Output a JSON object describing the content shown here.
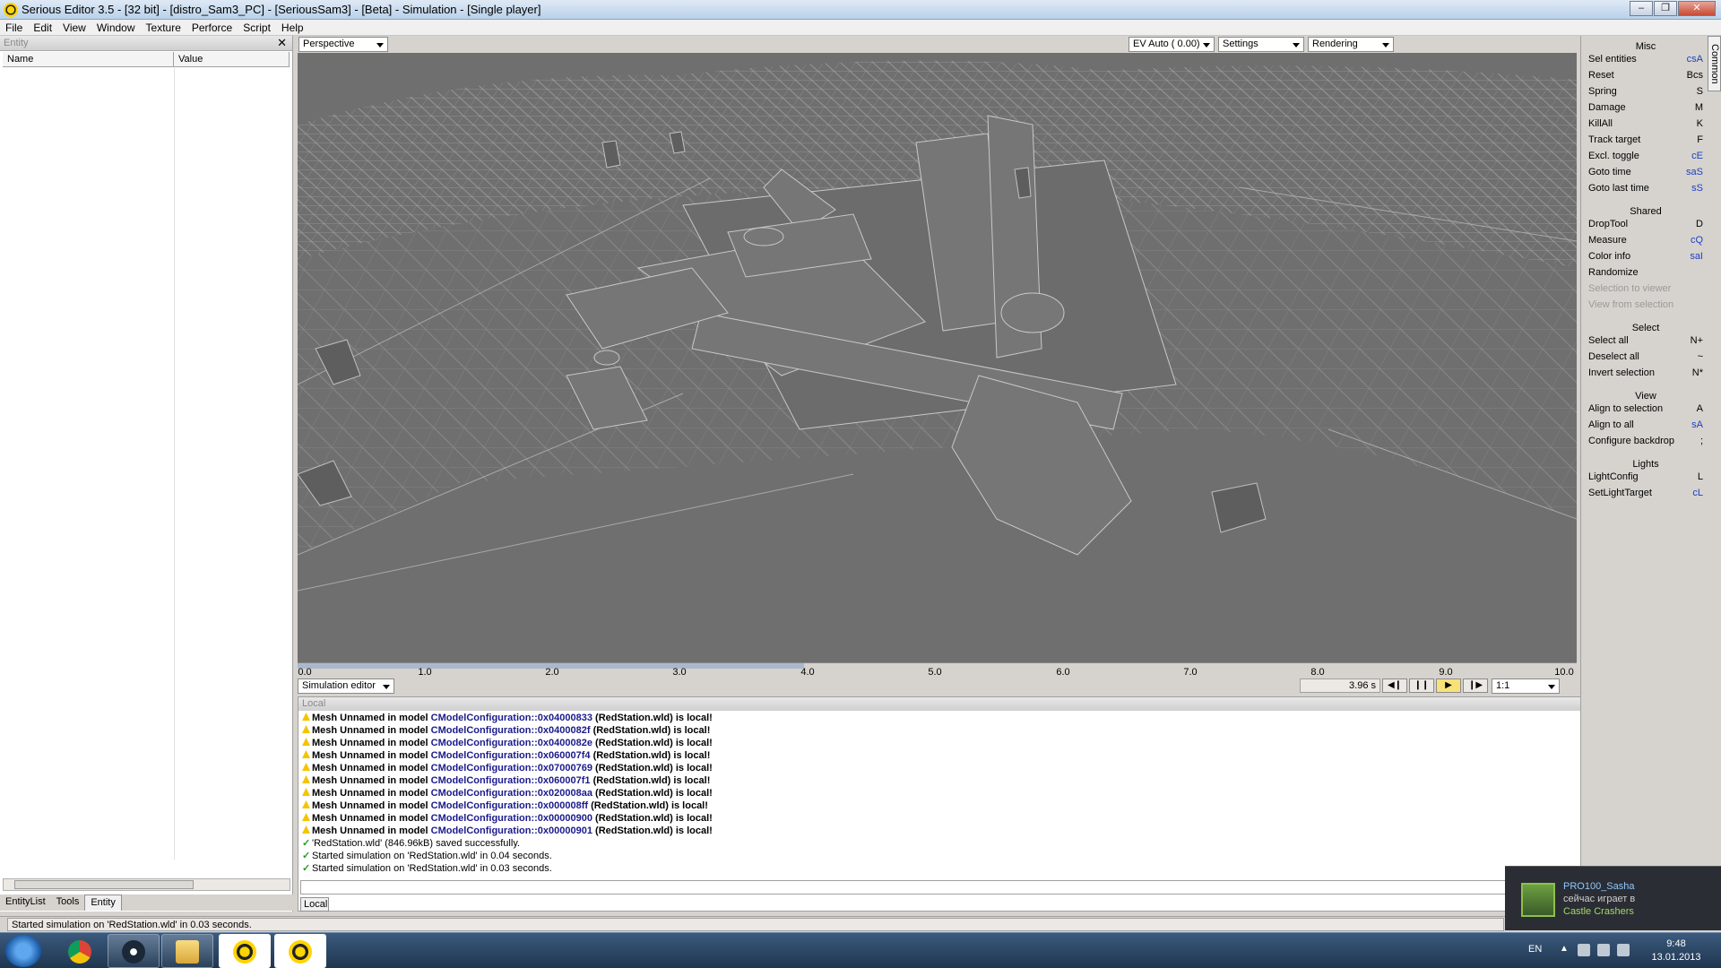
{
  "window": {
    "title": "Serious Editor 3.5 - [32 bit] - [distro_Sam3_PC] - [SeriousSam3] - [Beta] - Simulation - [Single player]"
  },
  "menu": [
    "File",
    "Edit",
    "View",
    "Window",
    "Texture",
    "Perforce",
    "Script",
    "Help"
  ],
  "entity_panel": {
    "header": "Entity",
    "col_name": "Name",
    "col_value": "Value",
    "tabs": [
      "EntityList",
      "Tools",
      "Entity"
    ]
  },
  "viewport_toolbar": {
    "view_mode": "Perspective",
    "exposure": "EV Auto ( 0.00)",
    "settings": "Settings",
    "rendering": "Rendering"
  },
  "timeline": {
    "ticks": [
      "0.0",
      "1.0",
      "2.0",
      "3.0",
      "4.0",
      "5.0",
      "6.0",
      "7.0",
      "8.0",
      "9.0",
      "10.0"
    ],
    "progress_fraction": 0.396
  },
  "sim_controls": {
    "mode": "Simulation editor",
    "time": "3.96 s",
    "speed": "1:1",
    "buttons": [
      "step-back",
      "pause",
      "play",
      "step-forward"
    ]
  },
  "log": {
    "header": "Local",
    "tab": "Local",
    "lines": [
      {
        "kind": "warn",
        "pre": "Mesh Unnamed in model ",
        "link": "CModelConfiguration::0x04000833",
        "post": " (RedStation.wld) is local!"
      },
      {
        "kind": "warn",
        "pre": "Mesh Unnamed in model ",
        "link": "CModelConfiguration::0x0400082f",
        "post": " (RedStation.wld) is local!"
      },
      {
        "kind": "warn",
        "pre": "Mesh Unnamed in model ",
        "link": "CModelConfiguration::0x0400082e",
        "post": " (RedStation.wld) is local!"
      },
      {
        "kind": "warn",
        "pre": "Mesh Unnamed in model ",
        "link": "CModelConfiguration::0x060007f4",
        "post": " (RedStation.wld) is local!"
      },
      {
        "kind": "warn",
        "pre": "Mesh Unnamed in model ",
        "link": "CModelConfiguration::0x07000769",
        "post": " (RedStation.wld) is local!"
      },
      {
        "kind": "warn",
        "pre": "Mesh Unnamed in model ",
        "link": "CModelConfiguration::0x060007f1",
        "post": " (RedStation.wld) is local!"
      },
      {
        "kind": "warn",
        "pre": "Mesh Unnamed in model ",
        "link": "CModelConfiguration::0x020008aa",
        "post": " (RedStation.wld) is local!"
      },
      {
        "kind": "warn",
        "pre": "Mesh Unnamed in model ",
        "link": "CModelConfiguration::0x000008ff",
        "post": " (RedStation.wld) is local!"
      },
      {
        "kind": "warn",
        "pre": "Mesh Unnamed in model ",
        "link": "CModelConfiguration::0x00000900",
        "post": " (RedStation.wld) is local!"
      },
      {
        "kind": "warn",
        "pre": "Mesh Unnamed in model ",
        "link": "CModelConfiguration::0x00000901",
        "post": " (RedStation.wld) is local!"
      },
      {
        "kind": "ok",
        "pre": "'RedStation.wld' (846.96kB) saved successfully.",
        "link": "",
        "post": ""
      },
      {
        "kind": "ok",
        "pre": "Started simulation on 'RedStation.wld' in 0.04 seconds.",
        "link": "",
        "post": ""
      },
      {
        "kind": "ok",
        "pre": "Started simulation on 'RedStation.wld' in 0.03 seconds.",
        "link": "",
        "post": ""
      }
    ]
  },
  "right_panel": {
    "tab": "Common",
    "sections": [
      {
        "title": "Misc",
        "items": [
          {
            "label": "Sel entities",
            "key": "csA",
            "blue": true
          },
          {
            "label": "Reset",
            "key": "Bcs",
            "blue": false
          },
          {
            "label": "Spring",
            "key": "S",
            "blue": false
          },
          {
            "label": "Damage",
            "key": "M",
            "blue": false
          },
          {
            "label": "KillAll",
            "key": "K",
            "blue": false
          },
          {
            "label": "Track target",
            "key": "F",
            "blue": false
          },
          {
            "label": "Excl. toggle",
            "key": "cE",
            "blue": true
          },
          {
            "label": "Goto time",
            "key": "saS",
            "blue": true
          },
          {
            "label": "Goto last time",
            "key": "sS",
            "blue": true
          }
        ]
      },
      {
        "title": "Shared",
        "items": [
          {
            "label": "DropTool",
            "key": "D",
            "blue": false
          },
          {
            "label": "Measure",
            "key": "cQ",
            "blue": true
          },
          {
            "label": "Color info",
            "key": "saI",
            "blue": true
          },
          {
            "label": "Randomize",
            "key": "",
            "blue": false
          },
          {
            "label": "Selection to viewer",
            "key": "",
            "blue": false,
            "disabled": true
          },
          {
            "label": "View from selection",
            "key": "",
            "blue": false,
            "disabled": true
          }
        ]
      },
      {
        "title": "Select",
        "items": [
          {
            "label": "Select all",
            "key": "N+",
            "blue": false
          },
          {
            "label": "Deselect all",
            "key": "~",
            "blue": false
          },
          {
            "label": "Invert selection",
            "key": "N*",
            "blue": false
          }
        ]
      },
      {
        "title": "View",
        "items": [
          {
            "label": "Align to selection",
            "key": "A",
            "blue": false
          },
          {
            "label": "Align to all",
            "key": "sA",
            "blue": true
          },
          {
            "label": "Configure backdrop",
            "key": ";",
            "blue": false
          }
        ]
      },
      {
        "title": "Lights",
        "items": [
          {
            "label": "LightConfig",
            "key": "L",
            "blue": false
          },
          {
            "label": "SetLightTarget",
            "key": "cL",
            "blue": true
          }
        ]
      }
    ]
  },
  "status": {
    "text": "Started simulation on 'RedStation.wld' in 0.03 seconds."
  },
  "steam_toast": {
    "user": "PRO100_Sasha",
    "action": "сейчас играет в",
    "game": "Castle Crashers"
  },
  "taskbar": {
    "apps": [
      "chrome-icon",
      "steam-icon",
      "explorer-icon",
      "serious-editor-icon",
      "serious-sam-icon"
    ],
    "lang": "EN",
    "time": "9:48",
    "date": "13.01.2013"
  }
}
